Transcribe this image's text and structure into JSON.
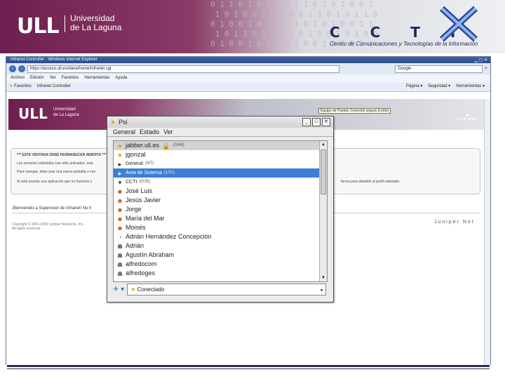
{
  "slide": {
    "university_logo": "ULL",
    "university_name_line1": "Universidad",
    "university_name_line2": "de La Laguna",
    "ccti_letters": "C C T I",
    "ccti_subtitle": "Centro de Comunicaciones y Tecnologías de la Información"
  },
  "browser": {
    "window_title": "Infranet Controller - Windows Internet Explorer",
    "url": "https://acceso.ull.es/dana/home/infranet.cgi",
    "search_placeholder": "Google",
    "menu": [
      "Archivo",
      "Edición",
      "Ver",
      "Favoritos",
      "Herramientas",
      "Ayuda"
    ],
    "favorites_label": "Favoritos",
    "tab_label": "Infranet Controller",
    "toolbar_right": [
      "Página ▾",
      "Seguridad ▾",
      "Herramientas ▾"
    ],
    "page": {
      "logo": "ULL",
      "name_line1": "Universidad",
      "name_line2": "de La Laguna",
      "tooltip": "Equipo de Puesta: Conexión segura (Leído)",
      "exit_label": "Cerrar sesión",
      "messages": [
        "*** ESTA VENTANA DEBE PERMANECER ABIERTA ***",
        "Los servicios solicitados han sido activados, esta",
        "Para navegar, debe usar una nueva pestaña o ven",
        "Si está usando una aplicación que no funcione y"
      ],
      "message_right": "forma para añadirle al perfil solicitado.",
      "welcome": "¡Bienvenido a Supervisor de Infranet! No h",
      "copyright_line1": "Copyright © 2001-2009 Juniper Networks, Inc.",
      "copyright_line2": "All rights reserved.",
      "juniper": "Juniper Net"
    }
  },
  "psi": {
    "title": "Psi",
    "menu": [
      "General",
      "Estado",
      "Ver"
    ],
    "account": {
      "name": "jabber.ull.es",
      "count": "(0/48)"
    },
    "groups": [
      {
        "name": "General",
        "count": "(4/7)",
        "selected": false
      },
      {
        "name": "Área de Sistema",
        "count": "(1/11)",
        "selected": true
      },
      {
        "name": "CCTI",
        "count": "(0/35)",
        "selected": false
      }
    ],
    "account_self": "jgonzal",
    "contacts": [
      {
        "name": "José Luis",
        "status": "online"
      },
      {
        "name": "Jesús Javier",
        "status": "online"
      },
      {
        "name": "Jorge",
        "status": "online"
      },
      {
        "name": "María del Mar",
        "status": "online"
      },
      {
        "name": "Moisés",
        "status": "online"
      },
      {
        "name": "Adrián Hernández Concepción",
        "status": "away"
      },
      {
        "name": "Adrián",
        "status": "offline"
      },
      {
        "name": "Agustín Abraham",
        "status": "offline"
      },
      {
        "name": "alfredocom",
        "status": "offline"
      },
      {
        "name": "alfredoges",
        "status": "offline"
      }
    ],
    "status_label": "Conectado"
  }
}
